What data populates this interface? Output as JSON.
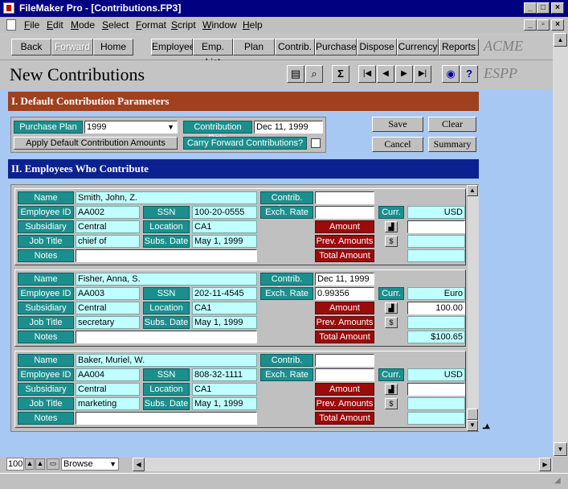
{
  "window": {
    "title": "FileMaker Pro - [Contributions.FP3]"
  },
  "menu": [
    "File",
    "Edit",
    "Mode",
    "Select",
    "Format",
    "Script",
    "Window",
    "Help"
  ],
  "nav": {
    "buttons": [
      "Back",
      "Forward",
      "Home",
      "Employee",
      "Emp. List",
      "Plan",
      "Contrib.",
      "Purchase",
      "Dispose",
      "Currency",
      "Reports"
    ],
    "brand1": "ACME",
    "brand2": "ESPP"
  },
  "page": {
    "title": "New Contributions"
  },
  "icons": {
    "sigma": "Σ",
    "help": "?"
  },
  "section1": {
    "title": "I. Default Contribution Parameters",
    "purchase_plan_label": "Purchase Plan",
    "purchase_plan_value": "1999",
    "contribution_date_label": "Contribution Date",
    "contribution_date_value": "Dec 11, 1999",
    "apply_button": "Apply Default Contribution Amounts",
    "carry_forward_label": "Carry Forward Contributions?",
    "save": "Save",
    "clear": "Clear",
    "cancel": "Cancel",
    "summary": "Summary"
  },
  "section2": {
    "title": "II. Employees Who Contribute"
  },
  "labels": {
    "name": "Name",
    "employee_id": "Employee ID",
    "subsidiary": "Subsidiary",
    "job_title": "Job Title",
    "notes": "Notes",
    "ssn": "SSN",
    "location": "Location",
    "subs_date": "Subs. Date",
    "contrib_date": "Contrib. Date",
    "exch_rate": "Exch. Rate",
    "amount": "Amount",
    "prev_amounts": "Prev. Amounts",
    "total_amount": "Total Amount",
    "curr": "Curr."
  },
  "employees": [
    {
      "name": "Smith, John, Z.",
      "employee_id": "AA002",
      "subsidiary": "Central",
      "job_title": "chief of",
      "notes": "",
      "ssn": "100-20-0555",
      "location": "CA1",
      "subs_date": "May 1, 1999",
      "contrib_date": "",
      "exch_rate": "",
      "currency": "USD",
      "amount": "",
      "prev_amounts": "",
      "total_amount": ""
    },
    {
      "name": "Fisher, Anna, S.",
      "employee_id": "AA003",
      "subsidiary": "Central",
      "job_title": "secretary",
      "notes": "",
      "ssn": "202-11-4545",
      "location": "CA1",
      "subs_date": "May 1, 1999",
      "contrib_date": "Dec 11, 1999",
      "exch_rate": "0.99356",
      "currency": "Euro",
      "amount": "100.00",
      "prev_amounts": "",
      "total_amount": "$100.65"
    },
    {
      "name": "Baker, Muriel, W.",
      "employee_id": "AA004",
      "subsidiary": "Central",
      "job_title": "marketing",
      "notes": "",
      "ssn": "808-32-1111",
      "location": "CA1",
      "subs_date": "May 1, 1999",
      "contrib_date": "",
      "exch_rate": "",
      "currency": "USD",
      "amount": "",
      "prev_amounts": "",
      "total_amount": ""
    }
  ],
  "status": {
    "zoom": "100",
    "mode": "Browse"
  }
}
